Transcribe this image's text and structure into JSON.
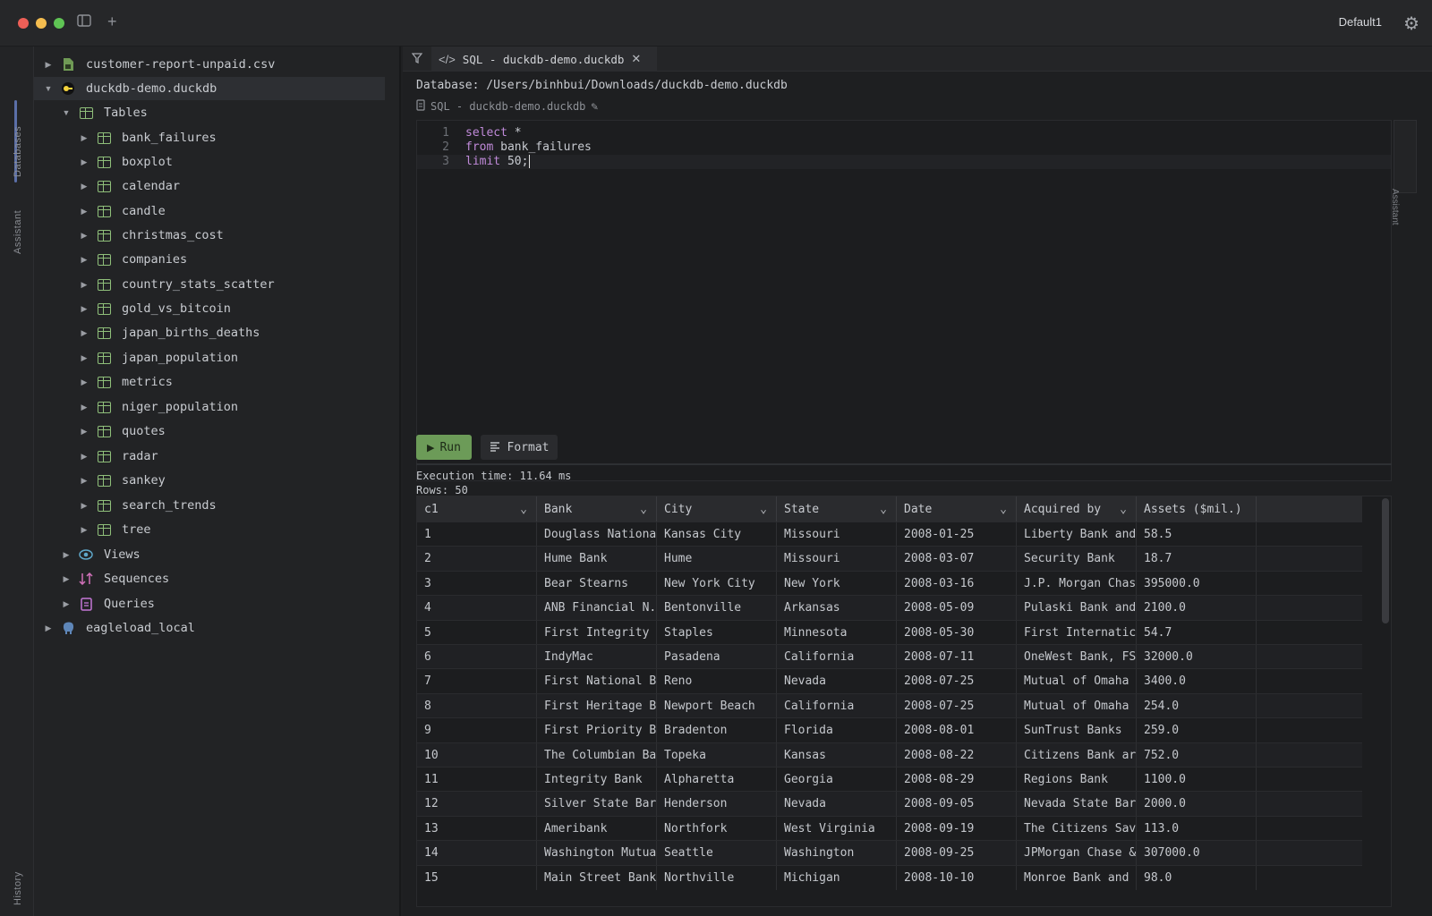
{
  "titlebar": {
    "profile": "Default1"
  },
  "rail": {
    "databases_label": "Databases",
    "assistant_label": "Assistant",
    "history_label": "History"
  },
  "sidebar": {
    "items": [
      {
        "label": "customer-report-unpaid.csv",
        "level": 0,
        "caret": "▶",
        "icon": "csv-file-icon"
      },
      {
        "label": "duckdb-demo.duckdb",
        "level": 0,
        "caret": "▼",
        "icon": "duckdb-icon"
      },
      {
        "label": "Tables",
        "level": 1,
        "caret": "▼",
        "icon": "table-icon"
      },
      {
        "label": "bank_failures",
        "level": 2,
        "caret": "▶",
        "icon": "table-icon"
      },
      {
        "label": "boxplot",
        "level": 2,
        "caret": "▶",
        "icon": "table-icon"
      },
      {
        "label": "calendar",
        "level": 2,
        "caret": "▶",
        "icon": "table-icon"
      },
      {
        "label": "candle",
        "level": 2,
        "caret": "▶",
        "icon": "table-icon"
      },
      {
        "label": "christmas_cost",
        "level": 2,
        "caret": "▶",
        "icon": "table-icon"
      },
      {
        "label": "companies",
        "level": 2,
        "caret": "▶",
        "icon": "table-icon"
      },
      {
        "label": "country_stats_scatter",
        "level": 2,
        "caret": "▶",
        "icon": "table-icon"
      },
      {
        "label": "gold_vs_bitcoin",
        "level": 2,
        "caret": "▶",
        "icon": "table-icon"
      },
      {
        "label": "japan_births_deaths",
        "level": 2,
        "caret": "▶",
        "icon": "table-icon"
      },
      {
        "label": "japan_population",
        "level": 2,
        "caret": "▶",
        "icon": "table-icon"
      },
      {
        "label": "metrics",
        "level": 2,
        "caret": "▶",
        "icon": "table-icon"
      },
      {
        "label": "niger_population",
        "level": 2,
        "caret": "▶",
        "icon": "table-icon"
      },
      {
        "label": "quotes",
        "level": 2,
        "caret": "▶",
        "icon": "table-icon"
      },
      {
        "label": "radar",
        "level": 2,
        "caret": "▶",
        "icon": "table-icon"
      },
      {
        "label": "sankey",
        "level": 2,
        "caret": "▶",
        "icon": "table-icon"
      },
      {
        "label": "search_trends",
        "level": 2,
        "caret": "▶",
        "icon": "table-icon"
      },
      {
        "label": "tree",
        "level": 2,
        "caret": "▶",
        "icon": "table-icon"
      },
      {
        "label": "Views",
        "level": 1,
        "caret": "▶",
        "icon": "eye-icon"
      },
      {
        "label": "Sequences",
        "level": 1,
        "caret": "▶",
        "icon": "sequence-icon"
      },
      {
        "label": "Queries",
        "level": 1,
        "caret": "▶",
        "icon": "query-icon"
      },
      {
        "label": "eagleload_local",
        "level": 0,
        "caret": "▶",
        "icon": "postgres-icon"
      }
    ]
  },
  "tab": {
    "label": "SQL - duckdb-demo.duckdb"
  },
  "editor": {
    "database_path": "Database: /Users/binhbui/Downloads/duckdb-demo.duckdb",
    "title": "SQL - duckdb-demo.duckdb",
    "lines": [
      {
        "num": "1",
        "kw": "select",
        "rest": " *"
      },
      {
        "num": "2",
        "kw": "from",
        "rest": " bank_failures"
      },
      {
        "num": "3",
        "kw": "limit",
        "rest": " 50;"
      }
    ]
  },
  "toolbar": {
    "run_label": "Run",
    "format_label": "Format"
  },
  "results": {
    "execution_time": "Execution time: 11.64 ms",
    "rows": "Rows: 50",
    "columns": [
      "c1",
      "Bank",
      "City",
      "State",
      "Date",
      "Acquired by",
      "Assets ($mil.)"
    ],
    "data": [
      [
        "1",
        "Douglass Nationa",
        "Kansas City",
        "Missouri",
        "2008-01-25",
        "Liberty Bank and",
        "58.5"
      ],
      [
        "2",
        "Hume Bank",
        "Hume",
        "Missouri",
        "2008-03-07",
        "Security Bank",
        "18.7"
      ],
      [
        "3",
        "Bear Stearns",
        "New York City",
        "New York",
        "2008-03-16",
        "J.P. Morgan Chas",
        "395000.0"
      ],
      [
        "4",
        "ANB Financial N.",
        "Bentonville",
        "Arkansas",
        "2008-05-09",
        "Pulaski Bank and",
        "2100.0"
      ],
      [
        "5",
        "First Integrity",
        "Staples",
        "Minnesota",
        "2008-05-30",
        "First Internatic",
        "54.7"
      ],
      [
        "6",
        "IndyMac",
        "Pasadena",
        "California",
        "2008-07-11",
        "OneWest Bank, FS",
        "32000.0"
      ],
      [
        "7",
        "First National B",
        "Reno",
        "Nevada",
        "2008-07-25",
        "Mutual of Omaha",
        "3400.0"
      ],
      [
        "8",
        "First Heritage B",
        "Newport Beach",
        "California",
        "2008-07-25",
        "Mutual of Omaha",
        "254.0"
      ],
      [
        "9",
        "First Priority B",
        "Bradenton",
        "Florida",
        "2008-08-01",
        "SunTrust Banks",
        "259.0"
      ],
      [
        "10",
        "The Columbian Ba",
        "Topeka",
        "Kansas",
        "2008-08-22",
        "Citizens Bank ar",
        "752.0"
      ],
      [
        "11",
        "Integrity Bank",
        "Alpharetta",
        "Georgia",
        "2008-08-29",
        "Regions Bank",
        "1100.0"
      ],
      [
        "12",
        "Silver State Bar",
        "Henderson",
        "Nevada",
        "2008-09-05",
        "Nevada State Bar",
        "2000.0"
      ],
      [
        "13",
        "Ameribank",
        "Northfork",
        "West Virginia",
        "2008-09-19",
        "The Citizens Sav",
        "113.0"
      ],
      [
        "14",
        "Washington Mutua",
        "Seattle",
        "Washington",
        "2008-09-25",
        "JPMorgan Chase &",
        "307000.0"
      ],
      [
        "15",
        "Main Street Bank",
        "Northville",
        "Michigan",
        "2008-10-10",
        "Monroe Bank and",
        "98.0"
      ]
    ]
  }
}
